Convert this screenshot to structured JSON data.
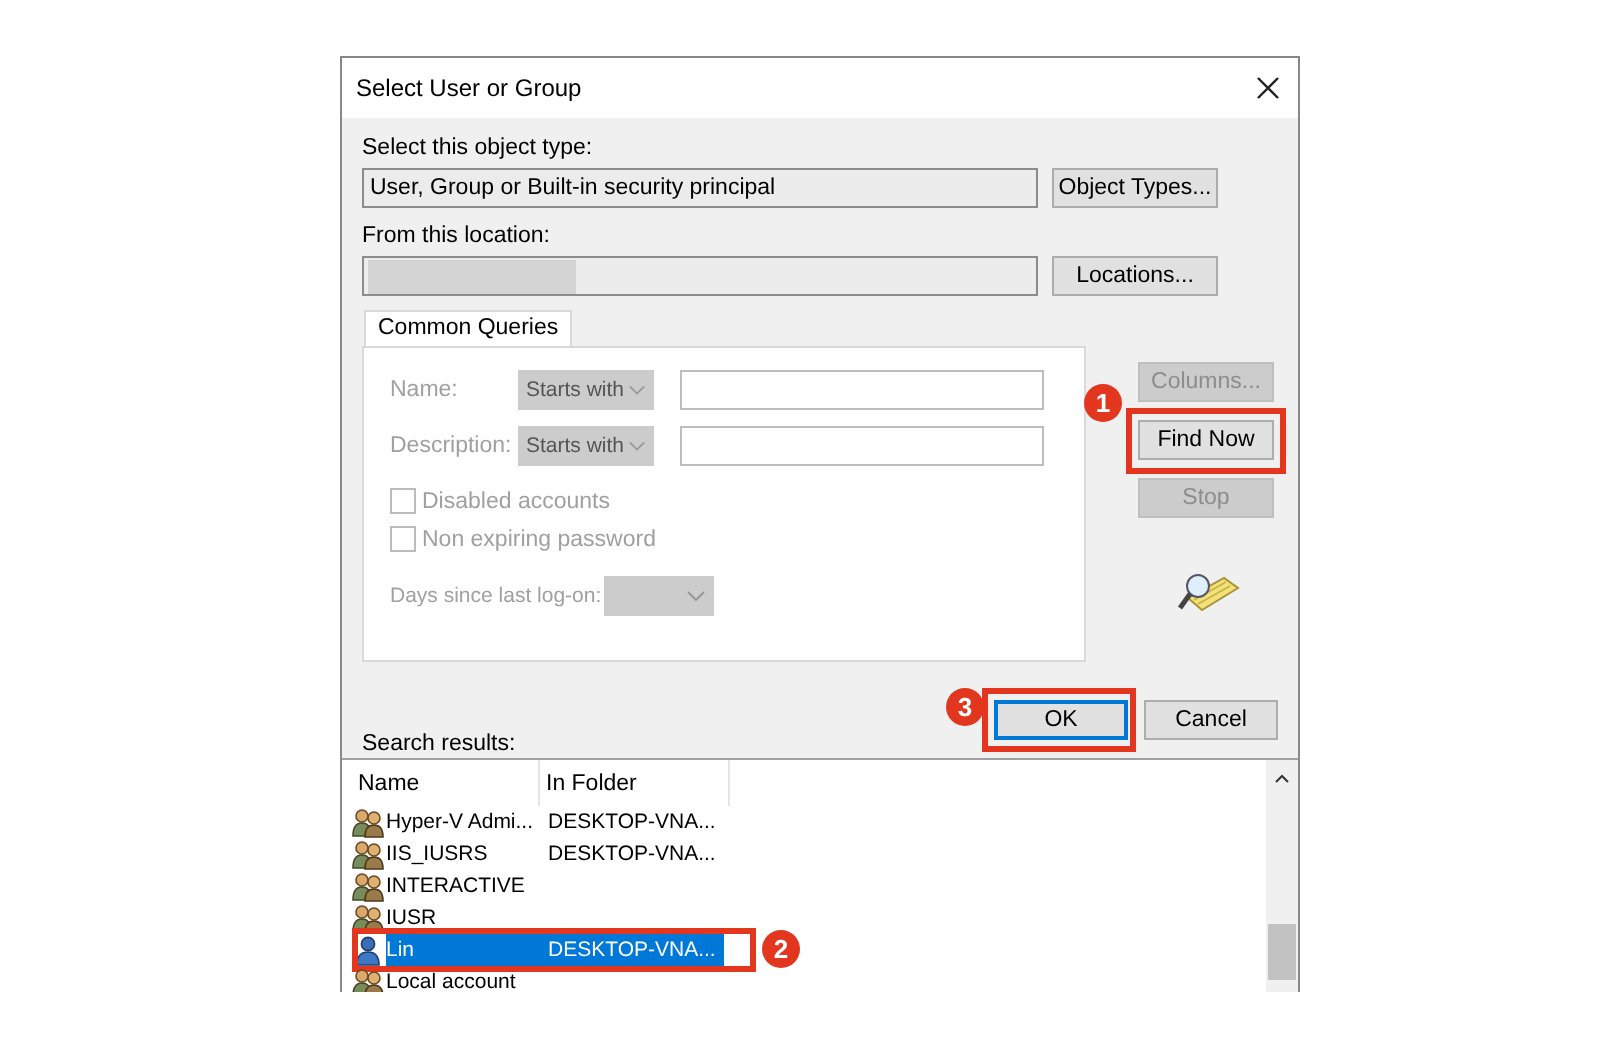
{
  "window": {
    "title": "Select User or Group"
  },
  "object_type": {
    "label": "Select this object type:",
    "value": "User, Group or Built-in security principal",
    "button": "Object Types..."
  },
  "location": {
    "label": "From this location:",
    "value_redacted": true,
    "button": "Locations..."
  },
  "query_tab": {
    "label": "Common Queries",
    "selected": true
  },
  "queries": {
    "disabled": true,
    "fields": [
      {
        "label": "Name:",
        "match": "Starts with"
      },
      {
        "label": "Description:",
        "match": "Starts with"
      }
    ],
    "checkboxes": [
      {
        "label": "Disabled accounts",
        "checked": false
      },
      {
        "label": "Non expiring password",
        "checked": false
      }
    ],
    "days_label": "Days since last log-on:"
  },
  "side_buttons": [
    {
      "label": "Columns...",
      "disabled": true
    },
    {
      "label": "Find Now",
      "disabled": false,
      "callout": "1"
    },
    {
      "label": "Stop",
      "disabled": true
    }
  ],
  "search_results_label": "Search results:",
  "dialog_buttons": [
    {
      "label": "OK",
      "default": true,
      "callout": "3"
    },
    {
      "label": "Cancel",
      "default": false
    }
  ],
  "results": {
    "columns": [
      "Name",
      "In Folder"
    ],
    "rows": [
      {
        "kind": "group",
        "name": "Hyper-V Admi...",
        "folder": "DESKTOP-VNA...",
        "selected": false
      },
      {
        "kind": "group",
        "name": "IIS_IUSRS",
        "folder": "DESKTOP-VNA...",
        "selected": false
      },
      {
        "kind": "group",
        "name": "INTERACTIVE",
        "selected": false
      },
      {
        "kind": "group",
        "name": "IUSR",
        "selected": false
      },
      {
        "kind": "user",
        "name": "Lin",
        "folder": "DESKTOP-VNA...",
        "selected": true,
        "callout": "2"
      },
      {
        "kind": "group",
        "name": "Local account",
        "selected": false
      }
    ]
  }
}
